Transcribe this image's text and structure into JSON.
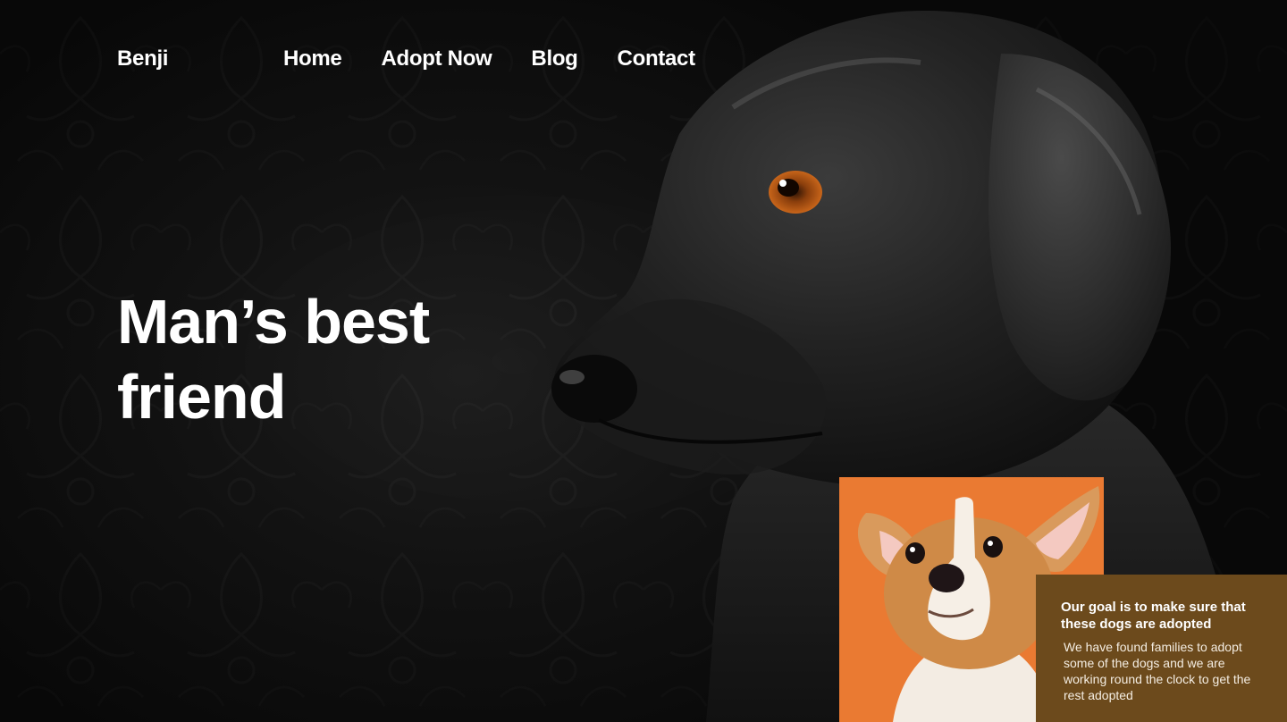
{
  "brand": {
    "name": "Benji"
  },
  "nav": {
    "home": "Home",
    "adopt": "Adopt Now",
    "blog": "Blog",
    "contact": "Contact"
  },
  "hero": {
    "headline_line1": "Man’s best",
    "headline_line2": "friend"
  },
  "info_card": {
    "title": "Our goal is to make sure that these dogs are adopted",
    "body": "We have found families to adopt some of the dogs and we are working round the clock to get the rest adopted"
  },
  "colors": {
    "background": "#0c0c0c",
    "text": "#ffffff",
    "corgi_card_bg": "#ea7a32",
    "info_card_bg": "#6c4a1c"
  },
  "images": {
    "hero_image": "black-labrador-dog",
    "card_image": "corgi-puppy"
  }
}
